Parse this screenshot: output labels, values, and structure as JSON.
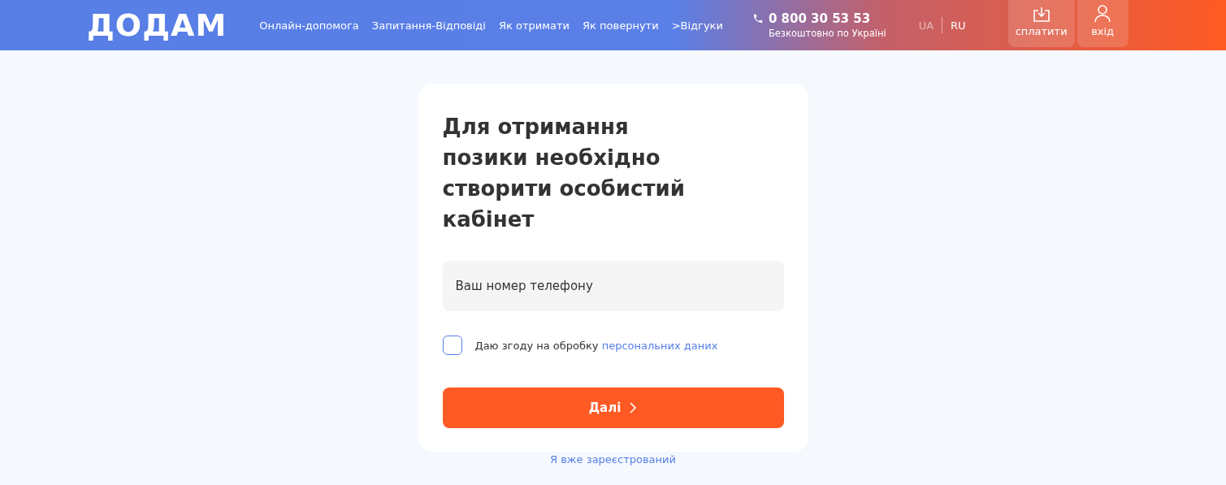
{
  "header": {
    "logo": "ДОДАМ",
    "nav": [
      "Онлайн-допомога",
      "Запитання-Відповіді",
      "Як отримати",
      "Як повернути",
      ">Відгуки"
    ],
    "phone": {
      "number": "0 800 30 53 53",
      "note": "Безкоштовно по Україні"
    },
    "languages": [
      {
        "label": "UA",
        "selected": false
      },
      {
        "label": "RU",
        "selected": true
      }
    ],
    "buttons": [
      {
        "kind": "pay",
        "label": "сплатити"
      },
      {
        "kind": "login",
        "label": "вхід"
      }
    ]
  },
  "form": {
    "title": "Для отримання позики необхідно створити особистий кабінет",
    "phone_field": {
      "placeholder": "Ваш номер телефону"
    },
    "consent": {
      "checked": false,
      "text": "Даю згоду на обробку",
      "link": "персональних даних"
    },
    "submit": "Далі",
    "login_link": "Я вже зареєстрований"
  }
}
